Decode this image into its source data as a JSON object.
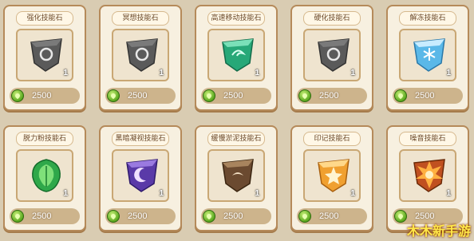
{
  "cards": [
    {
      "name": "强化技能石",
      "count": "1",
      "price": "2500",
      "gem": "gray"
    },
    {
      "name": "冥想技能石",
      "count": "1",
      "price": "2500",
      "gem": "gray"
    },
    {
      "name": "高速移动技能石",
      "count": "1",
      "price": "2500",
      "gem": "green-gem"
    },
    {
      "name": "硬化技能石",
      "count": "1",
      "price": "2500",
      "gem": "gray"
    },
    {
      "name": "解冻技能石",
      "count": "1",
      "price": "2500",
      "gem": "blue-gem"
    },
    {
      "name": "脱力粉技能石",
      "count": "1",
      "price": "2500",
      "gem": "green-leaf"
    },
    {
      "name": "黑暗凝视技能石",
      "count": "1",
      "price": "2500",
      "gem": "purple-moon"
    },
    {
      "name": "缓慢淤泥技能石",
      "count": "1",
      "price": "2500",
      "gem": "brown"
    },
    {
      "name": "印记技能石",
      "count": "1",
      "price": "2500",
      "gem": "orange-star"
    },
    {
      "name": "噪音技能石",
      "count": "1",
      "price": "2500",
      "gem": "fire"
    }
  ],
  "watermark": "木木新手游",
  "colors": {
    "gray": "#6e6e6e",
    "green-gem": "#2fbf8a",
    "blue-gem": "#6fc8f0",
    "green-leaf": "#2fa84a",
    "purple-moon": "#5a3aa8",
    "brown": "#8a6a4a",
    "orange-star": "#f0a030",
    "fire": "#d06020"
  }
}
